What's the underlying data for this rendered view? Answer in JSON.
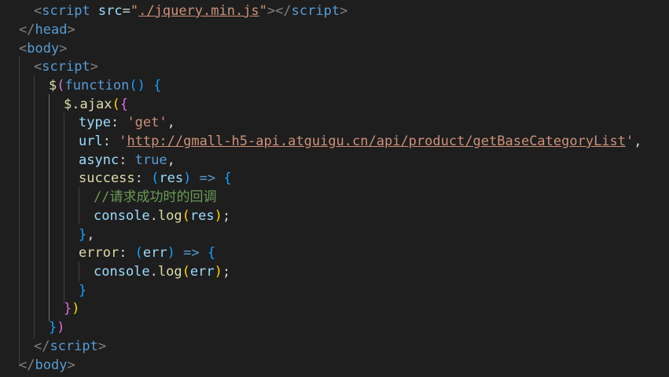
{
  "lines": [
    {
      "tokens": [
        {
          "t": "<",
          "c": "punct"
        },
        {
          "t": "script",
          "c": "tag"
        },
        {
          "t": " ",
          "c": "plain"
        },
        {
          "t": "src",
          "c": "attr"
        },
        {
          "t": "=",
          "c": "plain"
        },
        {
          "t": "\"",
          "c": "str"
        },
        {
          "t": "./jquery.min.js",
          "c": "link"
        },
        {
          "t": "\"",
          "c": "str"
        },
        {
          "t": "></",
          "c": "punct"
        },
        {
          "t": "script",
          "c": "tag"
        },
        {
          "t": ">",
          "c": "punct"
        }
      ]
    },
    {
      "tokens": [
        {
          "t": "</",
          "c": "punct"
        },
        {
          "t": "head",
          "c": "tag"
        },
        {
          "t": ">",
          "c": "punct"
        }
      ]
    },
    {
      "tokens": [
        {
          "t": "<",
          "c": "punct"
        },
        {
          "t": "body",
          "c": "tag"
        },
        {
          "t": ">",
          "c": "punct"
        }
      ]
    },
    {
      "tokens": [
        {
          "t": "<",
          "c": "punct"
        },
        {
          "t": "script",
          "c": "tag"
        },
        {
          "t": ">",
          "c": "punct"
        }
      ]
    },
    {
      "tokens": [
        {
          "t": "$",
          "c": "fn"
        },
        {
          "t": "(",
          "c": "b2"
        },
        {
          "t": "function",
          "c": "kw"
        },
        {
          "t": "() ",
          "c": "b3"
        },
        {
          "t": "{",
          "c": "b3"
        }
      ]
    },
    {
      "tokens": [
        {
          "t": "$",
          "c": "fn"
        },
        {
          "t": ".",
          "c": "plain"
        },
        {
          "t": "ajax",
          "c": "fn"
        },
        {
          "t": "(",
          "c": "b1"
        },
        {
          "t": "{",
          "c": "b2"
        }
      ]
    },
    {
      "tokens": [
        {
          "t": "type",
          "c": "prop"
        },
        {
          "t": ": ",
          "c": "plain"
        },
        {
          "t": "'get'",
          "c": "str"
        },
        {
          "t": ",",
          "c": "plain"
        }
      ]
    },
    {
      "tokens": [
        {
          "t": "url",
          "c": "prop"
        },
        {
          "t": ": ",
          "c": "plain"
        },
        {
          "t": "'",
          "c": "str"
        },
        {
          "t": "http://gmall-h5-api.atguigu.cn/api/product/getBaseCategoryList",
          "c": "link"
        },
        {
          "t": "'",
          "c": "str"
        },
        {
          "t": ",",
          "c": "plain"
        }
      ]
    },
    {
      "tokens": [
        {
          "t": "async",
          "c": "prop"
        },
        {
          "t": ": ",
          "c": "plain"
        },
        {
          "t": "true",
          "c": "kw"
        },
        {
          "t": ",",
          "c": "plain"
        }
      ]
    },
    {
      "tokens": [
        {
          "t": "success",
          "c": "fn"
        },
        {
          "t": ": ",
          "c": "plain"
        },
        {
          "t": "(",
          "c": "b3"
        },
        {
          "t": "res",
          "c": "param"
        },
        {
          "t": ")",
          "c": "b3"
        },
        {
          "t": " ",
          "c": "plain"
        },
        {
          "t": "=>",
          "c": "kw"
        },
        {
          "t": " ",
          "c": "plain"
        },
        {
          "t": "{",
          "c": "b3"
        }
      ]
    },
    {
      "tokens": [
        {
          "t": "//请求成功时的回调",
          "c": "comment"
        }
      ]
    },
    {
      "tokens": [
        {
          "t": "console",
          "c": "prop"
        },
        {
          "t": ".",
          "c": "plain"
        },
        {
          "t": "log",
          "c": "fn"
        },
        {
          "t": "(",
          "c": "b1"
        },
        {
          "t": "res",
          "c": "param"
        },
        {
          "t": ")",
          "c": "b1"
        },
        {
          "t": ";",
          "c": "plain"
        }
      ]
    },
    {
      "tokens": [
        {
          "t": "}",
          "c": "b3"
        },
        {
          "t": ",",
          "c": "plain"
        }
      ]
    },
    {
      "tokens": [
        {
          "t": "error",
          "c": "fn"
        },
        {
          "t": ": ",
          "c": "plain"
        },
        {
          "t": "(",
          "c": "b3"
        },
        {
          "t": "err",
          "c": "param"
        },
        {
          "t": ")",
          "c": "b3"
        },
        {
          "t": " ",
          "c": "plain"
        },
        {
          "t": "=>",
          "c": "kw"
        },
        {
          "t": " ",
          "c": "plain"
        },
        {
          "t": "{",
          "c": "b3"
        }
      ]
    },
    {
      "tokens": [
        {
          "t": "console",
          "c": "prop"
        },
        {
          "t": ".",
          "c": "plain"
        },
        {
          "t": "log",
          "c": "fn"
        },
        {
          "t": "(",
          "c": "b1"
        },
        {
          "t": "err",
          "c": "param"
        },
        {
          "t": ")",
          "c": "b1"
        },
        {
          "t": ";",
          "c": "plain"
        }
      ]
    },
    {
      "tokens": [
        {
          "t": "}",
          "c": "b3"
        }
      ]
    },
    {
      "tokens": [
        {
          "t": "}",
          "c": "b2"
        },
        {
          "t": ")",
          "c": "b1"
        }
      ]
    },
    {
      "tokens": [
        {
          "t": "}",
          "c": "b3"
        },
        {
          "t": ")",
          "c": "b2"
        }
      ]
    },
    {
      "tokens": [
        {
          "t": "</",
          "c": "punct"
        },
        {
          "t": "script",
          "c": "tag"
        },
        {
          "t": ">",
          "c": "punct"
        }
      ]
    },
    {
      "tokens": [
        {
          "t": "</",
          "c": "punct"
        },
        {
          "t": "body",
          "c": "tag"
        },
        {
          "t": ">",
          "c": "punct"
        }
      ]
    }
  ]
}
